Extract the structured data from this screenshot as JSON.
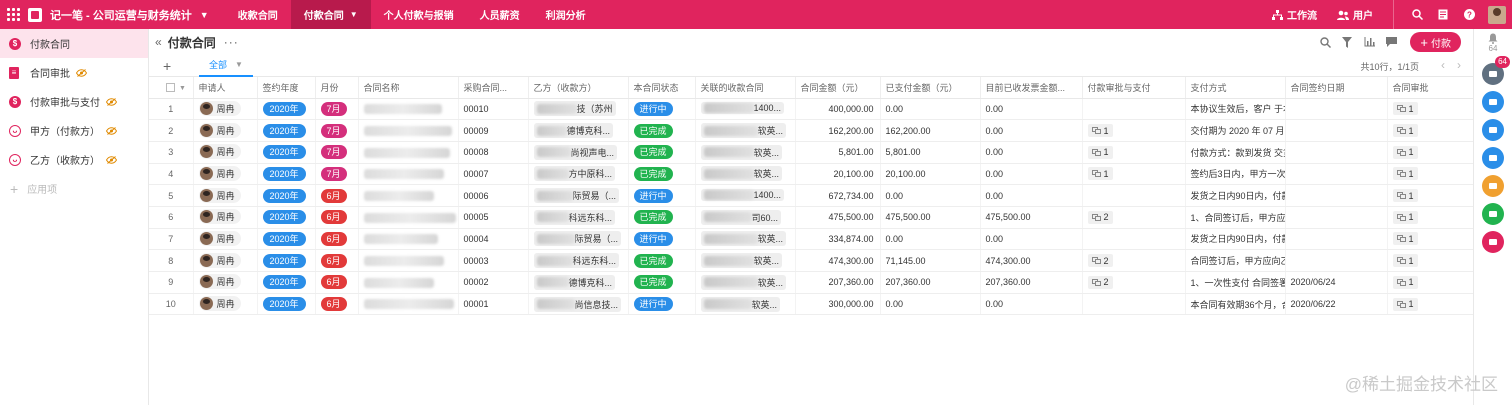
{
  "topbar": {
    "app_title": "记一笔 - 公司运营与财务统计",
    "nav": [
      {
        "label": "收款合同",
        "active": false
      },
      {
        "label": "付款合同",
        "active": true
      },
      {
        "label": "个人付款与报销",
        "active": false
      },
      {
        "label": "人员薪资",
        "active": false
      },
      {
        "label": "利润分析",
        "active": false
      }
    ],
    "workflow_label": "工作流",
    "users_label": "用户",
    "colors": {
      "brand": "#e0245e",
      "active_tab": "#b81a4c"
    }
  },
  "sidebar": {
    "items": [
      {
        "label": "付款合同",
        "icon": "dollar-icon",
        "active": true,
        "hidden": false
      },
      {
        "label": "合同审批",
        "icon": "document-icon",
        "active": false,
        "hidden": true
      },
      {
        "label": "付款审批与支付",
        "icon": "dollar-icon",
        "active": false,
        "hidden": true
      },
      {
        "label": "甲方（付款方）",
        "icon": "face-icon",
        "active": false,
        "hidden": true
      },
      {
        "label": "乙方（收款方）",
        "icon": "face-icon",
        "active": false,
        "hidden": true
      }
    ],
    "add_label": "应用项"
  },
  "main": {
    "title": "付款合同",
    "add_button": "付款",
    "view_tab": "全部",
    "row_count": "共10行，1/1页"
  },
  "table": {
    "columns": [
      "申请人",
      "签约年度",
      "月份",
      "合同名称",
      "采购合同...",
      "乙方（收款方）",
      "本合同状态",
      "关联的收款合同",
      "合同金额（元）",
      "已支付金额（元）",
      "目前已收发票金额...",
      "付款审批与支付",
      "支付方式",
      "合同签约日期",
      "合同审批"
    ],
    "rows": [
      {
        "idx": "1",
        "applicant": "周冉",
        "year": "2020年",
        "month": "7月",
        "contract_no": "00010",
        "party_b_visible": "技（苏州",
        "status": "进行中",
        "related_visible": "1400...",
        "amount": "400,000.00",
        "paid": "0.00",
        "invoice": "0.00",
        "payment_count": "",
        "payment_method": "本协议生效后，客户 于本",
        "sign_date": "",
        "approval": "1"
      },
      {
        "idx": "2",
        "applicant": "周冉",
        "year": "2020年",
        "month": "7月",
        "contract_no": "00009",
        "party_b_visible": "德博克科...",
        "status": "已完成",
        "related_visible": "软英...",
        "amount": "162,200.00",
        "paid": "162,200.00",
        "invoice": "0.00",
        "payment_count": "1",
        "payment_method": "交付期为 2020 年 07 月 2(",
        "sign_date": "",
        "approval": "1"
      },
      {
        "idx": "3",
        "applicant": "周冉",
        "year": "2020年",
        "month": "7月",
        "contract_no": "00008",
        "party_b_visible": "尚视声电...",
        "status": "已完成",
        "related_visible": "软英...",
        "amount": "5,801.00",
        "paid": "5,801.00",
        "invoice": "0.00",
        "payment_count": "1",
        "payment_method": "付款方式：款到发货 交货",
        "sign_date": "",
        "approval": "1"
      },
      {
        "idx": "4",
        "applicant": "周冉",
        "year": "2020年",
        "month": "7月",
        "contract_no": "00007",
        "party_b_visible": "方中原科...",
        "status": "已完成",
        "related_visible": "软英...",
        "amount": "20,100.00",
        "paid": "20,100.00",
        "invoice": "0.00",
        "payment_count": "1",
        "payment_method": "签约后3日内，甲方一次性",
        "sign_date": "",
        "approval": "1"
      },
      {
        "idx": "5",
        "applicant": "周冉",
        "year": "2020年",
        "month": "6月",
        "contract_no": "00006",
        "party_b_visible": "际贸易（...",
        "status": "进行中",
        "related_visible": "1400...",
        "amount": "672,734.00",
        "paid": "0.00",
        "invoice": "0.00",
        "payment_count": "",
        "payment_method": "发货之日内90日内，付款",
        "sign_date": "",
        "approval": "1"
      },
      {
        "idx": "6",
        "applicant": "周冉",
        "year": "2020年",
        "month": "6月",
        "contract_no": "00005",
        "party_b_visible": "科远东科...",
        "status": "已完成",
        "related_visible": "司60...",
        "amount": "475,500.00",
        "paid": "475,500.00",
        "invoice": "475,500.00",
        "payment_count": "2",
        "payment_method": "1、合同签订后，甲方应向",
        "sign_date": "",
        "approval": "1"
      },
      {
        "idx": "7",
        "applicant": "周冉",
        "year": "2020年",
        "month": "6月",
        "contract_no": "00004",
        "party_b_visible": "际贸易（...",
        "status": "进行中",
        "related_visible": "软英...",
        "amount": "334,874.00",
        "paid": "0.00",
        "invoice": "0.00",
        "payment_count": "",
        "payment_method": "发货之日内90日内，付款",
        "sign_date": "",
        "approval": "1"
      },
      {
        "idx": "8",
        "applicant": "周冉",
        "year": "2020年",
        "month": "6月",
        "contract_no": "00003",
        "party_b_visible": "科远东科...",
        "status": "已完成",
        "related_visible": "软英...",
        "amount": "474,300.00",
        "paid": "71,145.00",
        "invoice": "474,300.00",
        "payment_count": "2",
        "payment_method": "合同签订后，甲方应向乙ブ",
        "sign_date": "",
        "approval": "1"
      },
      {
        "idx": "9",
        "applicant": "周冉",
        "year": "2020年",
        "month": "6月",
        "contract_no": "00002",
        "party_b_visible": "德博克科...",
        "status": "已完成",
        "related_visible": "软英...",
        "amount": "207,360.00",
        "paid": "207,360.00",
        "invoice": "207,360.00",
        "payment_count": "2",
        "payment_method": "1、一次性支付 合同签署",
        "sign_date": "2020/06/24",
        "approval": "1"
      },
      {
        "idx": "10",
        "applicant": "周冉",
        "year": "2020年",
        "month": "6月",
        "contract_no": "00001",
        "party_b_visible": "尚信息技...",
        "status": "进行中",
        "related_visible": "软英...",
        "amount": "300,000.00",
        "paid": "0.00",
        "invoice": "0.00",
        "payment_count": "",
        "payment_method": "本合同有效期36个月，合",
        "sign_date": "2020/06/22",
        "approval": "1"
      }
    ],
    "status_colors": {
      "进行中": "#2a8ee8",
      "已完成": "#21b34f"
    },
    "month_colors": {
      "7月": "#d42f7c",
      "6月": "#e23a3a"
    },
    "year_color": "#2a8ee8"
  },
  "rail": {
    "notification_count": "64",
    "badge_count": "64",
    "buttons": [
      {
        "icon": "briefcase-icon",
        "color": "#607080"
      },
      {
        "icon": "chat-icon",
        "color": "#2a8ee8"
      },
      {
        "icon": "bell-icon",
        "color": "#2a8ee8"
      },
      {
        "icon": "org-chart-icon",
        "color": "#2a8ee8"
      },
      {
        "icon": "apps-icon",
        "color": "#f0a030"
      },
      {
        "icon": "check-circle-icon",
        "color": "#21b34f"
      },
      {
        "icon": "calendar-icon",
        "color": "#e0245e"
      }
    ]
  },
  "watermark": "@稀土掘金技术社区"
}
